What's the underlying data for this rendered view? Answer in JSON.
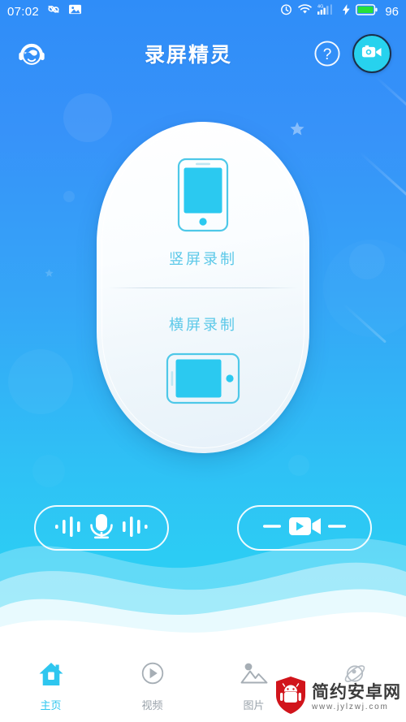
{
  "theme": {
    "bg_top": "#2f8df8",
    "bg_bottom": "#2ad2f4",
    "accent_cyan": "#2ec6ef",
    "card_label_color": "#5bc8e8",
    "nav_inactive": "#9aa3ab",
    "battery_green": "#26e03a",
    "record_btn_bg": "#27d2ee"
  },
  "statusbar": {
    "time": "07:02",
    "battery_percent": "96",
    "left_icons": [
      "infinity-icon",
      "screenshot-icon"
    ],
    "right_icons": [
      "alarm-icon",
      "wifi-icon",
      "signal-4g-icon",
      "charging-bolt-icon",
      "battery-icon"
    ],
    "network_label": "4G"
  },
  "header": {
    "avatar_icon": "headphones-face-icon",
    "title": "录屏精灵",
    "help_label": "?",
    "help_icon": "help-circle-icon",
    "record_icon": "video-camera-icon"
  },
  "card": {
    "portrait": {
      "icon": "phone-portrait-icon",
      "label": "竖屏录制"
    },
    "landscape": {
      "icon": "phone-landscape-icon",
      "label": "横屏录制"
    }
  },
  "actions": [
    {
      "name": "microphone-button",
      "icon": "microphone-waves-icon"
    },
    {
      "name": "video-button",
      "icon": "video-play-icon"
    }
  ],
  "bottom_nav": [
    {
      "label": "主页",
      "icon": "home-icon",
      "active": true
    },
    {
      "label": "视频",
      "icon": "play-circle-icon",
      "active": false
    },
    {
      "label": "图片",
      "icon": "image-mountain-icon",
      "active": false
    },
    {
      "label": "",
      "icon": "rocket-planet-icon",
      "active": false
    }
  ],
  "watermark": {
    "name": "简约安卓网",
    "url": "www.jylzwj.com",
    "logo_icon": "android-shield-icon"
  }
}
